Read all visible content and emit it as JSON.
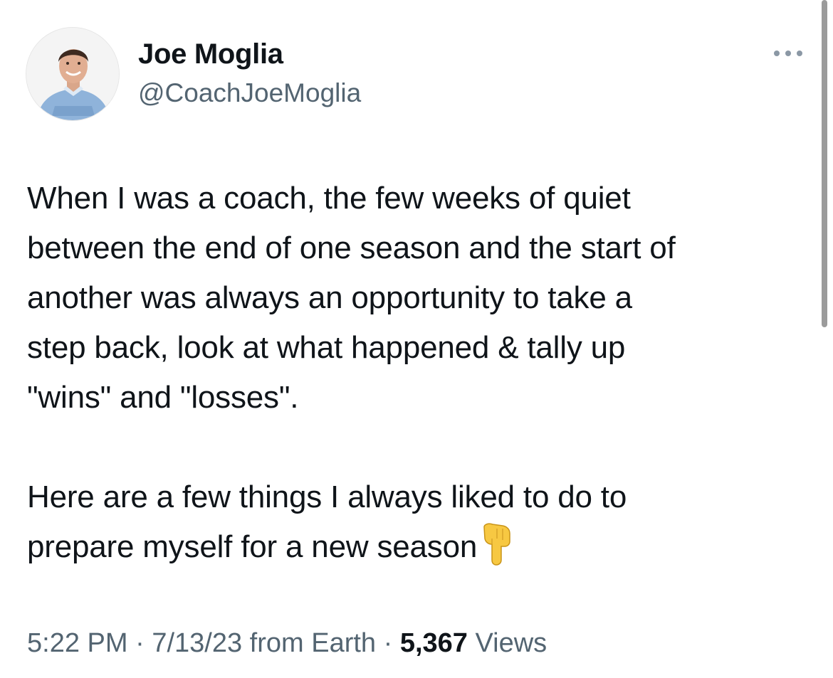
{
  "author": {
    "display_name": "Joe Moglia",
    "handle": "@CoachJoeMoglia"
  },
  "tweet": {
    "lines_p1": [
      "When I was a coach, the few weeks of quiet",
      "between the end of one season and the start of",
      "another was always an opportunity to take a",
      "step back, look at what happened & tally up",
      "\"wins\" and \"losses\"."
    ],
    "lines_p2": [
      "Here are a few things I always liked to do to",
      "prepare myself for a new season"
    ],
    "trailing_emoji": "backhand-index-pointing-down-icon"
  },
  "meta": {
    "time": "5:22 PM",
    "sep1": " · ",
    "date": "7/13/23",
    "source": " from Earth",
    "sep2": " · ",
    "views_count": "5,367",
    "views_label": " Views"
  },
  "icons": {
    "more": "more-horizontal-icon"
  },
  "colors": {
    "text_primary": "#0f1419",
    "text_secondary": "#536471",
    "more_dots": "#8b98a5",
    "emoji_yellow": "#f7c842"
  }
}
